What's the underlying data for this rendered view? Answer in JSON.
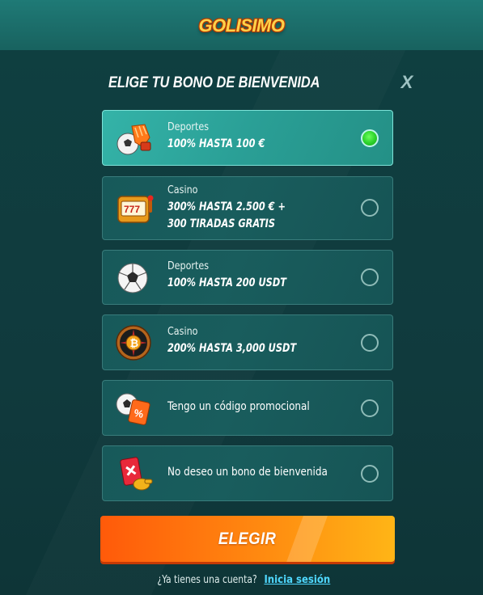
{
  "brand": {
    "logo_text": "GOLISIMO"
  },
  "modal": {
    "title": "ELIGE TU BONO DE BIENVENIDA",
    "close_label": "X"
  },
  "options": [
    {
      "category": "Deportes",
      "amount": "100% HASTA 100 €",
      "icon": "glove-ball-icon",
      "selected": true
    },
    {
      "category": "Casino",
      "amount_line1": "300% HASTA 2.500 € +",
      "amount_line2": "300 TIRADAS GRATIS",
      "icon": "slot-machine-icon",
      "selected": false
    },
    {
      "category": "Deportes",
      "amount": "100% HASTA 200 USDT",
      "icon": "soccer-ball-icon",
      "selected": false
    },
    {
      "category": "Casino",
      "amount": "200% HASTA 3,000 USDT",
      "icon": "roulette-bitcoin-icon",
      "selected": false
    },
    {
      "label": "Tengo un código promocional",
      "icon": "promo-ticket-icon",
      "selected": false
    },
    {
      "label": "No deseo un bono de bienvenida",
      "icon": "red-card-whistle-icon",
      "selected": false
    }
  ],
  "cta": {
    "label": "ELEGIR"
  },
  "login": {
    "question": "¿Ya tienes una cuenta?",
    "link": "Inicia sesión"
  },
  "colors": {
    "accent_orange": "#ff8a10",
    "selected_teal": "#2a9f96",
    "radio_green": "#2bd12a",
    "link_blue": "#4fd8ff"
  }
}
